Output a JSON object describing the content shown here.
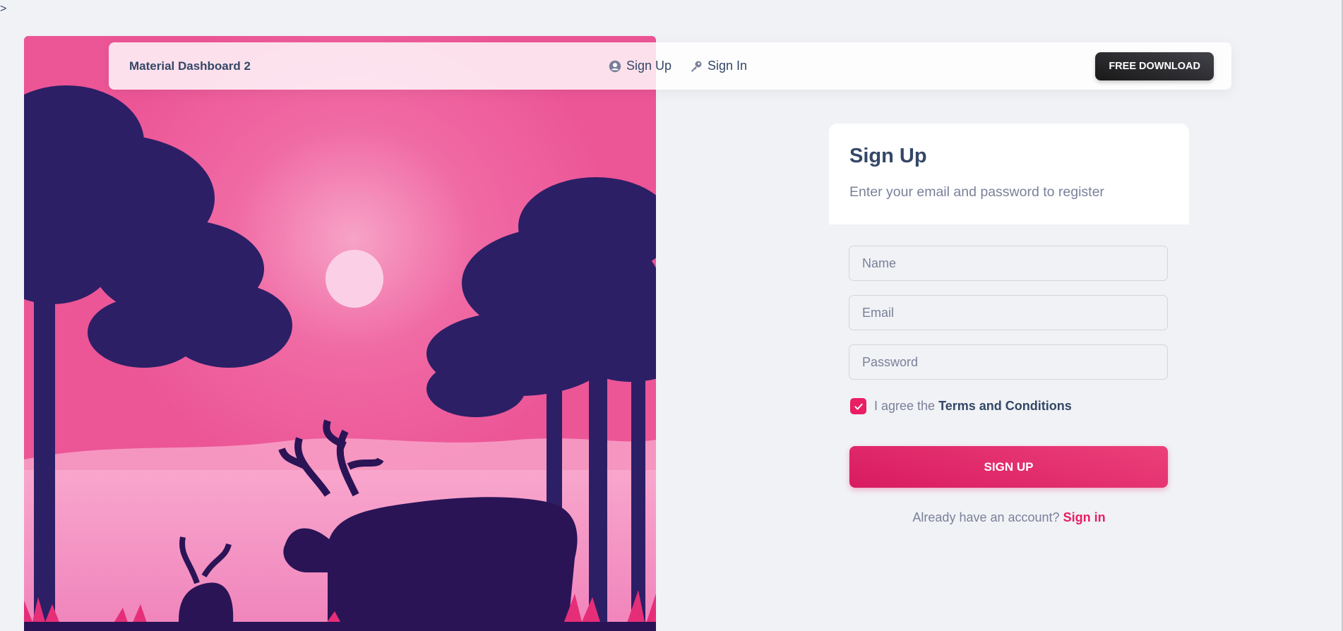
{
  "page": {
    "stray_text": ">"
  },
  "navbar": {
    "brand": "Material Dashboard 2",
    "links": [
      {
        "label": "Sign Up",
        "icon": "account-circle-icon"
      },
      {
        "label": "Sign In",
        "icon": "key-icon"
      }
    ],
    "download_label": "FREE DOWNLOAD"
  },
  "card": {
    "title": "Sign Up",
    "subtitle": "Enter your email and password to register"
  },
  "form": {
    "name_placeholder": "Name",
    "email_placeholder": "Email",
    "password_placeholder": "Password",
    "agree_prefix": "I agree the",
    "terms_label": "Terms and Conditions",
    "agree_checked": true,
    "submit_label": "SIGN UP"
  },
  "footer": {
    "prompt": "Already have an account?",
    "link_label": "Sign in"
  },
  "colors": {
    "primary": "#e91e63",
    "dark_text": "#344767",
    "muted_text": "#7b809a",
    "page_background": "#f0f2f5"
  }
}
